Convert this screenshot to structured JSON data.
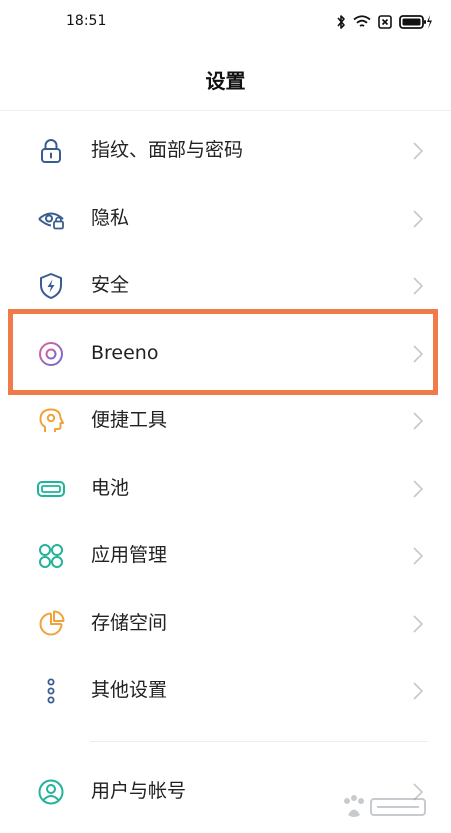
{
  "status_bar": {
    "time": "18:51",
    "icons": [
      "bluetooth-icon",
      "wifi-icon",
      "sim-off-icon",
      "battery-charging-icon"
    ]
  },
  "header": {
    "title": "设置"
  },
  "items": [
    {
      "label": "指纹、面部与密码",
      "icon": "lock-icon",
      "color": "#3a5d8f"
    },
    {
      "label": "隐私",
      "icon": "privacy-eye-icon",
      "color": "#3a5d8f"
    },
    {
      "label": "安全",
      "icon": "shield-bolt-icon",
      "color": "#3a5d8f"
    },
    {
      "label": "Breeno",
      "icon": "breeno-ring-icon",
      "color": "#8a5cc8"
    },
    {
      "label": "便捷工具",
      "icon": "assist-head-icon",
      "color": "#f2a23a"
    },
    {
      "label": "电池",
      "icon": "battery-icon",
      "color": "#22b39a"
    },
    {
      "label": "应用管理",
      "icon": "apps-icon",
      "color": "#22b39a"
    },
    {
      "label": "存储空间",
      "icon": "storage-pie-icon",
      "color": "#f2a23a"
    },
    {
      "label": "其他设置",
      "icon": "more-dots-icon",
      "color": "#3a5d8f"
    }
  ],
  "bottom_item": {
    "label": "用户与帐号",
    "icon": "user-icon",
    "color": "#22b39a"
  },
  "highlight": {
    "color": "#ef7a4a",
    "target": "Breeno"
  }
}
